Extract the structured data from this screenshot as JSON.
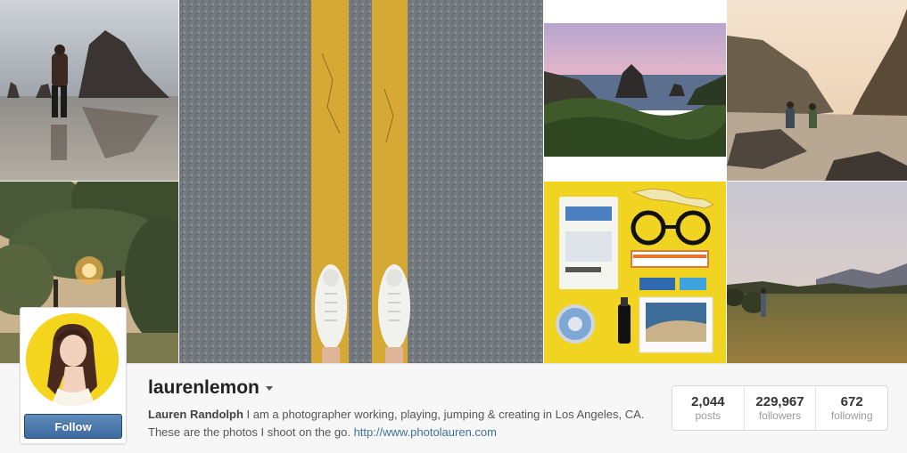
{
  "mosaic": {
    "photos": [
      {
        "subject": "haystack-rock-beach"
      },
      {
        "subject": "road-yellow-lines-sneakers"
      },
      {
        "subject": "sea-stacks-sunset"
      },
      {
        "subject": "couple-hiking-cove"
      },
      {
        "subject": "forest-sunlight"
      },
      {
        "subject": "sasquatch-flatlay"
      },
      {
        "subject": "hiker-meadow-dusk"
      }
    ]
  },
  "profile": {
    "username": "laurenlemon",
    "full_name": "Lauren Randolph",
    "bio": "I am a photographer working, playing, jumping & creating in Los Angeles, CA. These are the photos I shoot on the go.",
    "website": "http://www.photolauren.com",
    "follow_label": "Follow"
  },
  "stats": [
    {
      "value": "2,044",
      "label": "posts"
    },
    {
      "value": "229,967",
      "label": "followers"
    },
    {
      "value": "672",
      "label": "following"
    }
  ],
  "colors": {
    "follow_button": "#3c6a9e",
    "link": "#3f729b",
    "avatar_background": "#f3d51e"
  }
}
